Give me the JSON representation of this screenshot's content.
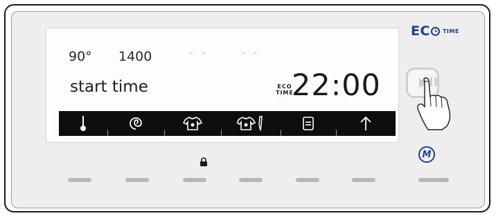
{
  "display": {
    "temperature": "90°",
    "spin": "1400",
    "dash1": "- -",
    "dash2": "- -",
    "status_label": "start time",
    "eco_line1": "ECO",
    "eco_line2": "TIME",
    "clock": "22:00"
  },
  "icon_bar": [
    {
      "icon": "thermometer-icon"
    },
    {
      "icon": "spin-icon"
    },
    {
      "icon": "shirt-icon"
    },
    {
      "icon": "shirt-stain-icon"
    },
    {
      "icon": "options-icon"
    },
    {
      "icon": "arrow-up-icon"
    }
  ],
  "brand": {
    "eco": "EC",
    "time": "TIME",
    "color": "#1d3f8e"
  },
  "buttons": {
    "start_pause": "▶II",
    "menu": "M"
  }
}
